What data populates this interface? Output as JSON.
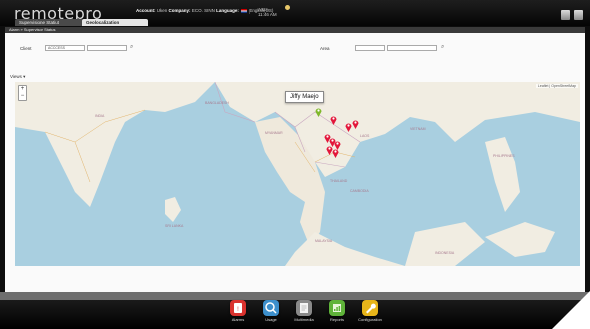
{
  "app": {
    "logo": "remotepro",
    "account_label": "Account:",
    "account_value": "Uken",
    "company_label": "Company:",
    "company_value": "ECO. SINN",
    "language_label": "Language:",
    "language_value": "English(US)",
    "location_line1": "ASIA",
    "location_line2": "11:46 AM"
  },
  "tabs": [
    {
      "label": "Supervisione Statiut"
    },
    {
      "label": "Geolocalization"
    }
  ],
  "breadcrumb": "Alarm » Supervisor Status",
  "filters": {
    "client_label": "Client",
    "client_value": "ACCCESS",
    "area_label": "Area",
    "area_value": ""
  },
  "view_label": "Views ▾",
  "map": {
    "zoom_in": "+",
    "zoom_out": "−",
    "attribution": "Leaflet | OpenStreetMap",
    "tooltip": "Jiffy Maejo",
    "colors": {
      "sea": "#a9cfe0",
      "land": "#f1ede2",
      "pin_red": "#e3163a",
      "pin_green": "#7fb82a"
    }
  },
  "map_labels": [
    "INDIA",
    "BANGLADESH",
    "MYANMAR",
    "THAILAND",
    "LAOS",
    "VIETNAM",
    "CAMBODIA",
    "MALAYSIA",
    "PHILIPPINES",
    "SRI LANKA",
    "INDONESIA"
  ],
  "dock": [
    {
      "label": "Alarms",
      "icon": "alarm-icon",
      "color": "#d9322e"
    },
    {
      "label": "Usage",
      "icon": "magnifier-icon",
      "color": "#3c8fcc"
    },
    {
      "label": "Multimedia",
      "icon": "document-icon",
      "color": "#8a8a8a"
    },
    {
      "label": "Reports",
      "icon": "chart-icon",
      "color": "#5fb33a"
    },
    {
      "label": "Configuration",
      "icon": "wrench-icon",
      "color": "#e7b51a"
    }
  ]
}
